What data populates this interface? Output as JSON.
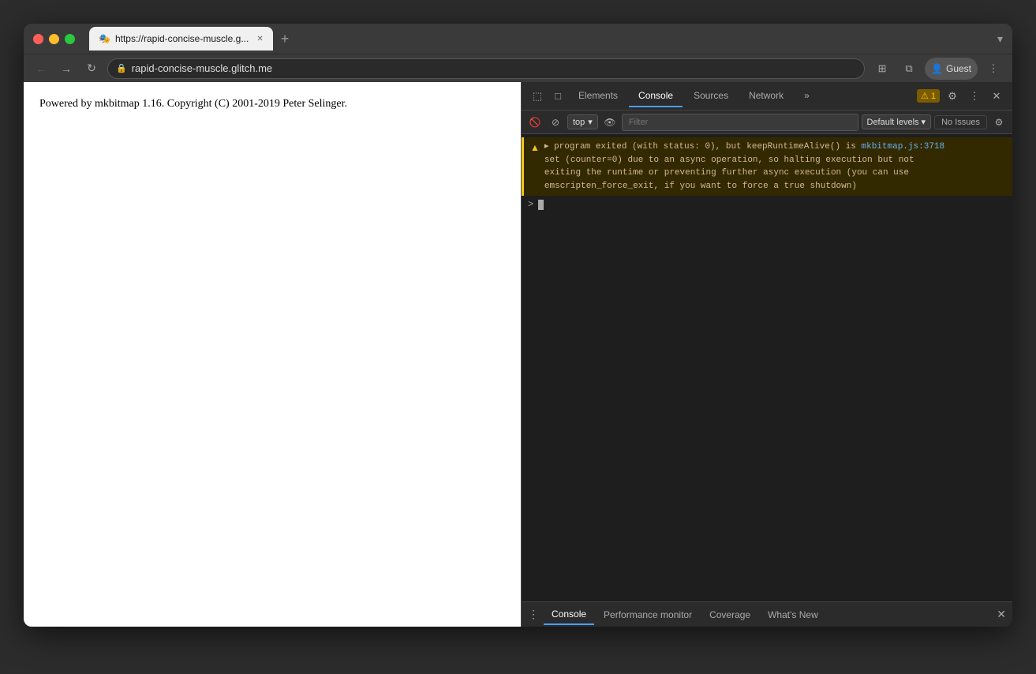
{
  "window": {
    "traffic_lights": [
      "red",
      "yellow",
      "green"
    ]
  },
  "tab": {
    "favicon": "🎭",
    "title": "https://rapid-concise-muscle.g...",
    "close": "✕",
    "new_tab": "+"
  },
  "nav": {
    "back": "←",
    "forward": "→",
    "reload": "↻",
    "url": "rapid-concise-muscle.glitch.me",
    "lock": "🔒",
    "extensions_icon": "⊞",
    "split_icon": "⧉",
    "user_label": "Guest",
    "more": "⋮",
    "user_icon": "👤"
  },
  "page": {
    "content": "Powered by mkbitmap 1.16. Copyright (C) 2001-2019 Peter Selinger."
  },
  "devtools": {
    "tabs": [
      "Elements",
      "Console",
      "Sources",
      "Network",
      "»"
    ],
    "active_tab": "Console",
    "toolbar_icons": {
      "warning_count": "1",
      "settings": "⚙",
      "more": "⋮",
      "close": "✕",
      "cursor": "⬚",
      "mobile": "□"
    },
    "console_toolbar": {
      "clear": "🚫",
      "ban": "⊘",
      "context": "top",
      "eye": "👁",
      "filter_placeholder": "Filter",
      "default_levels": "Default levels",
      "no_issues": "No Issues",
      "settings": "⚙"
    },
    "warning": {
      "icon": "▲",
      "line1": "▸ program exited (with status: 0), but keepRuntimeAlive() is",
      "link_text": "mkbitmap.js:3718",
      "line2": "set (counter=0) due to an async operation, so halting execution but not",
      "line3": "exiting the runtime or preventing further async execution (you can use",
      "line4": "emscripten_force_exit, if you want to force a true shutdown)"
    },
    "prompt": ">",
    "bottom_tabs": [
      "Console",
      "Performance monitor",
      "Coverage",
      "What's New"
    ],
    "active_bottom_tab": "Console"
  }
}
